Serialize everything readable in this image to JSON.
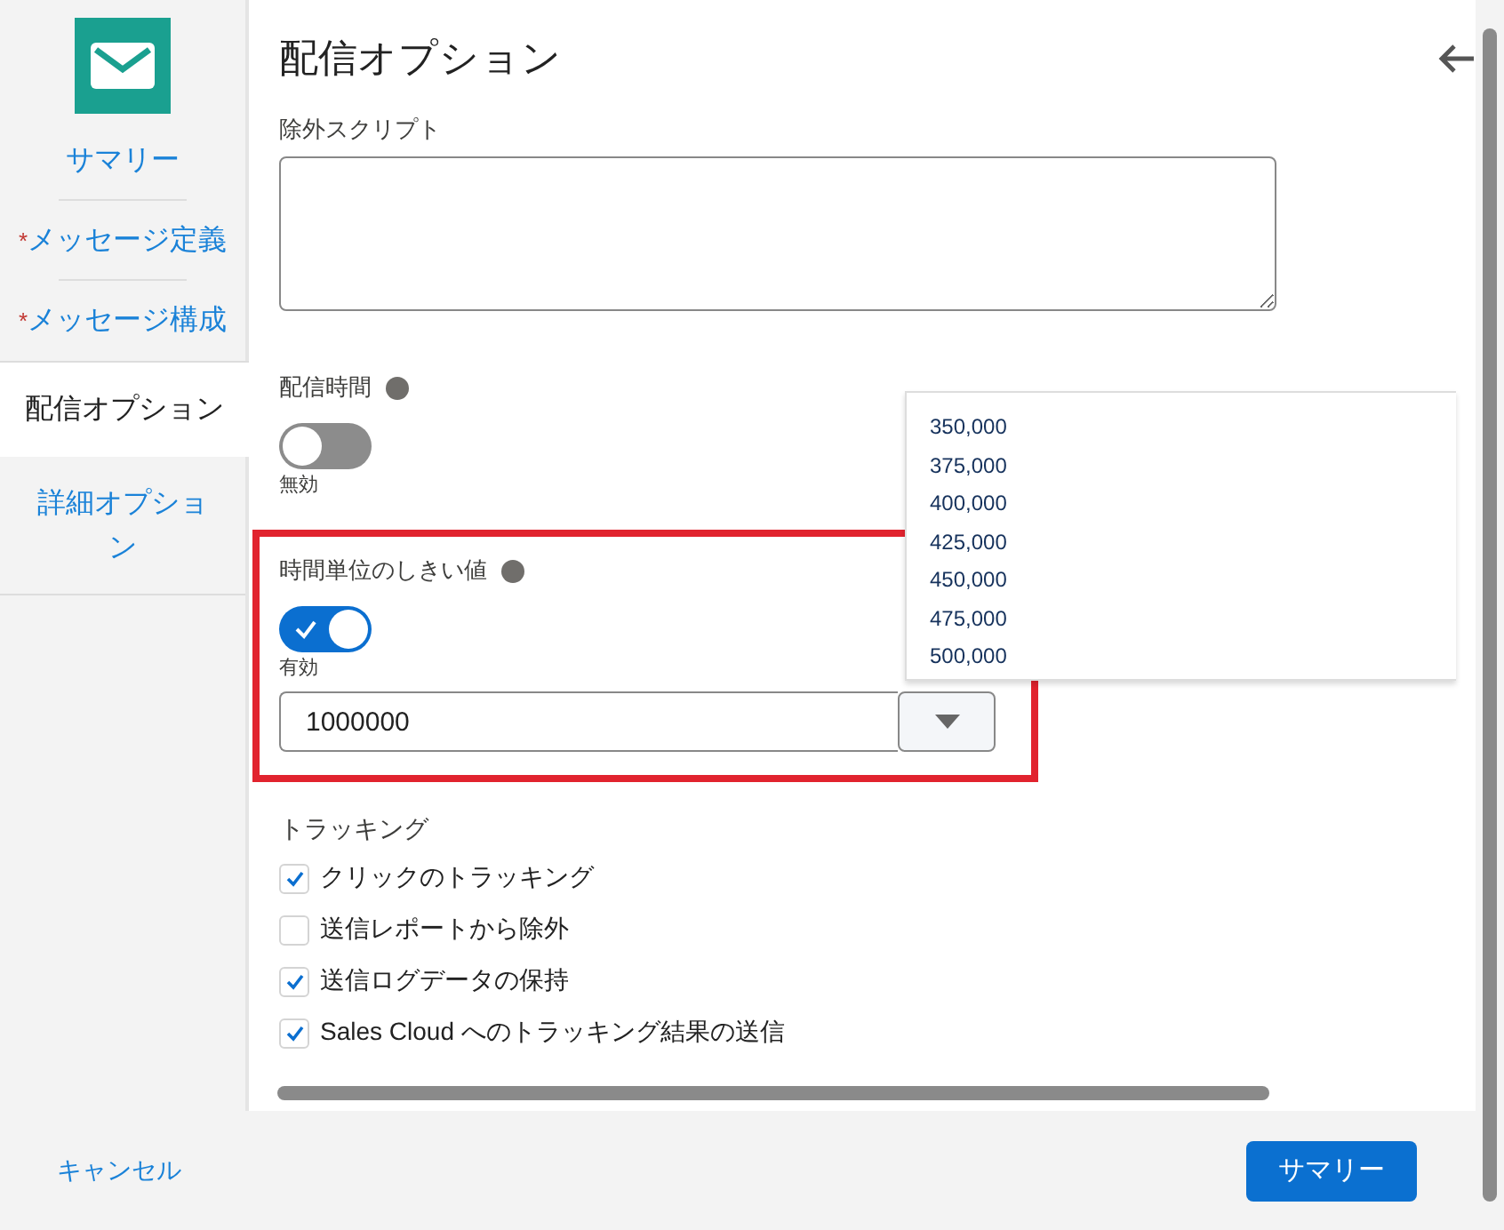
{
  "sidebar": {
    "required_mark": "*",
    "items": [
      {
        "label": "サマリー",
        "required": false,
        "selected": false
      },
      {
        "label": "メッセージ定義",
        "required": true,
        "selected": false
      },
      {
        "label": "メッセージ構成",
        "required": true,
        "selected": false
      },
      {
        "label": "配信オプション",
        "required": false,
        "selected": true
      },
      {
        "label": "詳細オプション",
        "required": false,
        "selected": false
      }
    ]
  },
  "panel": {
    "title": "配信オプション",
    "exclusion_script": {
      "label": "除外スクリプト"
    },
    "send_time": {
      "label": "配信時間",
      "on": false,
      "state_text": "無効"
    },
    "hourly_threshold": {
      "label": "時間単位のしきい値",
      "on": true,
      "state_text": "有効",
      "value": "1000000",
      "options": [
        "350,000",
        "375,000",
        "400,000",
        "425,000",
        "450,000",
        "475,000",
        "500,000"
      ]
    },
    "tracking": {
      "label": "トラッキング",
      "items": [
        {
          "label": "クリックのトラッキング",
          "checked": true
        },
        {
          "label": "送信レポートから除外",
          "checked": false
        },
        {
          "label": "送信ログデータの保持",
          "checked": true
        },
        {
          "label": "Sales Cloud へのトラッキング結果の送信",
          "checked": true
        }
      ]
    }
  },
  "footer": {
    "cancel": "キャンセル",
    "next": "サマリー"
  }
}
